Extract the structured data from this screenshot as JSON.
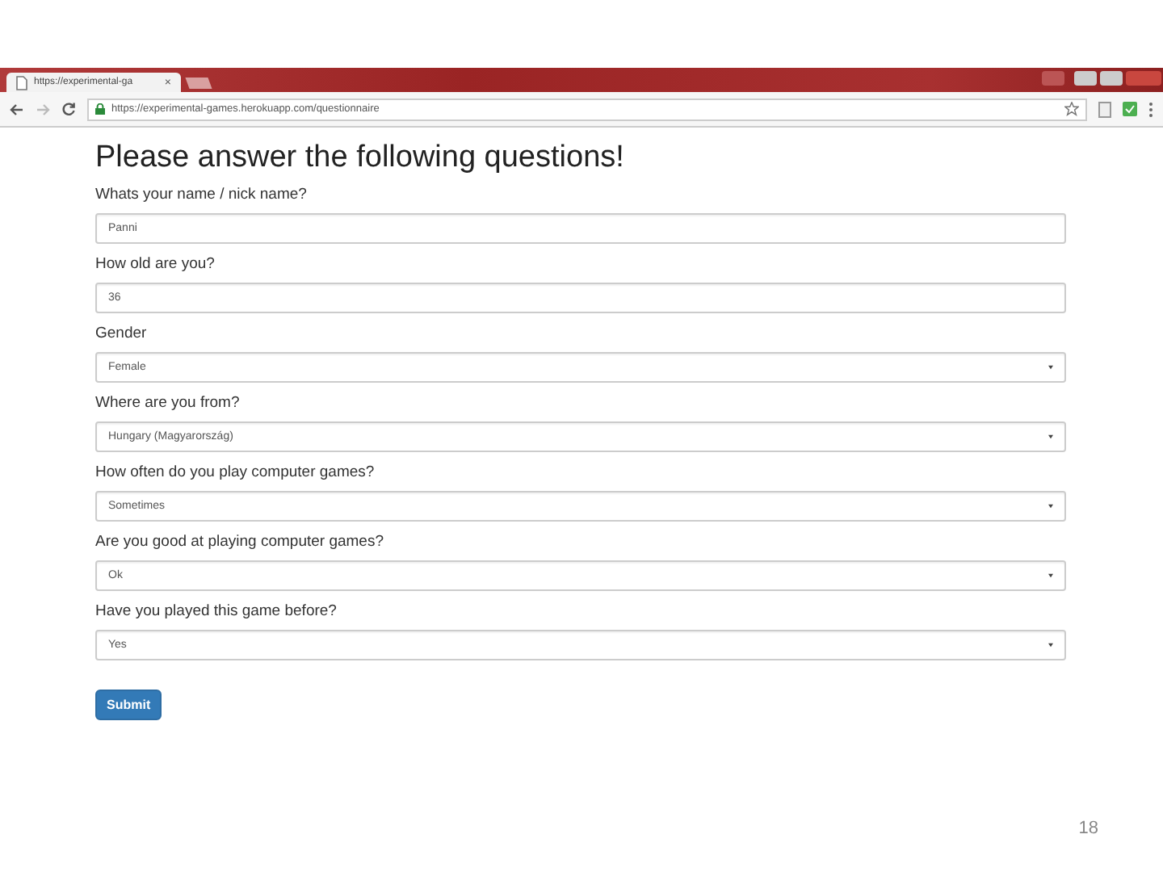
{
  "browser": {
    "tab_title": "https://experimental-ga",
    "tab_close": "×",
    "url": "https://experimental-games.herokuapp.com/questionnaire"
  },
  "form": {
    "title": "Please answer the following questions!",
    "questions": [
      {
        "kind": "text",
        "label": "Whats your name / nick name?",
        "value": "Panni"
      },
      {
        "kind": "text",
        "label": "How old are you?",
        "value": "36"
      },
      {
        "kind": "select",
        "label": "Gender",
        "value": "Female"
      },
      {
        "kind": "select",
        "label": "Where are you from?",
        "value": "Hungary (Magyarország)"
      },
      {
        "kind": "select",
        "label": "How often do you play computer games?",
        "value": "Sometimes"
      },
      {
        "kind": "select",
        "label": "Are you good at playing computer games?",
        "value": "Ok"
      },
      {
        "kind": "select",
        "label": "Have you played this game before?",
        "value": "Yes"
      }
    ],
    "submit": "Submit"
  },
  "slide_number": "18"
}
